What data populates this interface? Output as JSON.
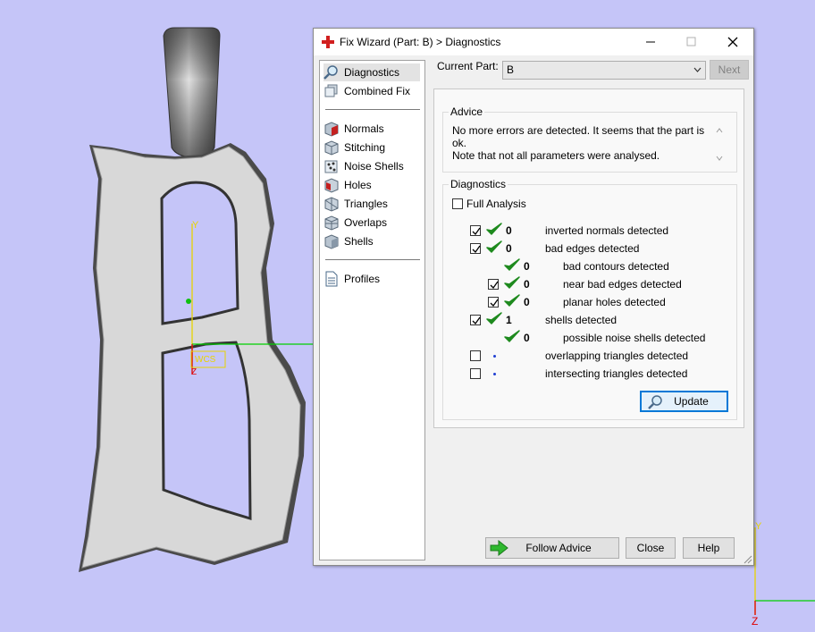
{
  "window": {
    "title": "Fix Wizard (Part: B) > Diagnostics",
    "minimize": "—",
    "maximize": "☐",
    "close": "✕"
  },
  "nav": {
    "items": [
      {
        "label": "Diagnostics",
        "icon": "magnifier-icon",
        "selected": true
      },
      {
        "label": "Combined Fix",
        "icon": "stack-icon"
      },
      {
        "label": "Normals",
        "icon": "cube-red-icon"
      },
      {
        "label": "Stitching",
        "icon": "cube-edges-icon"
      },
      {
        "label": "Noise Shells",
        "icon": "noise-cube-icon"
      },
      {
        "label": "Holes",
        "icon": "cube-hole-icon"
      },
      {
        "label": "Triangles",
        "icon": "cube-triangles-icon"
      },
      {
        "label": "Overlaps",
        "icon": "cube-overlap-icon"
      },
      {
        "label": "Shells",
        "icon": "cube-shells-icon"
      },
      {
        "label": "Profiles",
        "icon": "document-icon"
      }
    ]
  },
  "current_part": {
    "label": "Current Part:",
    "value": "B"
  },
  "next_button": "Next",
  "advice": {
    "title": "Advice",
    "line1": "No more errors are detected. It seems that the part is ok.",
    "line2": "Note that not all parameters were analysed."
  },
  "diagnostics": {
    "title": "Diagnostics",
    "full_analysis": {
      "label": "Full Analysis",
      "checked": false
    },
    "rows": [
      {
        "checkbox": true,
        "checked": true,
        "status": "ok",
        "count": "0",
        "label": "inverted normals detected"
      },
      {
        "checkbox": true,
        "checked": true,
        "status": "ok",
        "count": "0",
        "label": "bad edges detected"
      },
      {
        "checkbox": false,
        "status": "ok",
        "count": "0",
        "label": "bad contours detected"
      },
      {
        "checkbox": true,
        "checked": true,
        "status": "ok",
        "count": "0",
        "label": "near bad edges detected"
      },
      {
        "checkbox": true,
        "checked": true,
        "status": "ok",
        "count": "0",
        "label": "planar holes detected"
      },
      {
        "checkbox": true,
        "checked": true,
        "status": "ok",
        "count": "1",
        "label": "shells detected"
      },
      {
        "checkbox": false,
        "status": "ok",
        "count": "0",
        "label": "possible noise shells detected"
      },
      {
        "checkbox": true,
        "checked": false,
        "status": "pending",
        "count": "",
        "label": "overlapping triangles detected"
      },
      {
        "checkbox": true,
        "checked": false,
        "status": "pending",
        "count": "",
        "label": "intersecting triangles detected"
      }
    ],
    "update_button": "Update"
  },
  "footer": {
    "follow_advice": "Follow Advice",
    "close": "Close",
    "help": "Help"
  },
  "viewport": {
    "axis_y": "Y",
    "axis_z": "Z",
    "wcs_label": "WCS"
  },
  "colors": {
    "background": "#c5c5f8",
    "check_green": "#1e8a1e",
    "axis_yellow": "#e8d400",
    "axis_red": "#e00000",
    "axis_green": "#00d000"
  }
}
